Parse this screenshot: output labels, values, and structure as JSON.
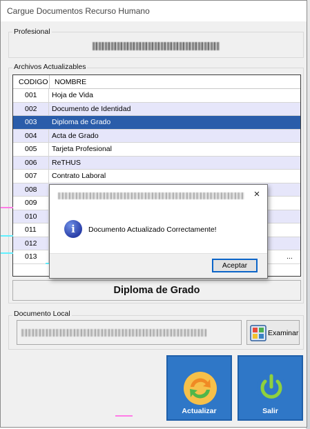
{
  "window": {
    "title": "Cargue Documentos Recurso Humano"
  },
  "profesional": {
    "label": "Profesional",
    "name_redacted": true
  },
  "archivos": {
    "label": "Archivos Actualizables",
    "columns": [
      "CODIGO",
      "NOMBRE"
    ],
    "rows": [
      {
        "codigo": "001",
        "nombre": "Hoja de Vida",
        "state": "normal"
      },
      {
        "codigo": "002",
        "nombre": "Documento de Identidad",
        "state": "alt"
      },
      {
        "codigo": "003",
        "nombre": "Diploma de Grado",
        "state": "selected"
      },
      {
        "codigo": "004",
        "nombre": "Acta de Grado",
        "state": "alt"
      },
      {
        "codigo": "005",
        "nombre": "Tarjeta Profesional",
        "state": "normal"
      },
      {
        "codigo": "006",
        "nombre": "ReTHUS",
        "state": "alt"
      },
      {
        "codigo": "007",
        "nombre": "Contrato Laboral",
        "state": "normal"
      },
      {
        "codigo": "008",
        "nombre": "",
        "state": "alt"
      },
      {
        "codigo": "009",
        "nombre": "",
        "state": "normal"
      },
      {
        "codigo": "010",
        "nombre": "",
        "state": "alt"
      },
      {
        "codigo": "011",
        "nombre": "",
        "state": "normal"
      },
      {
        "codigo": "012",
        "nombre": "",
        "state": "alt"
      },
      {
        "codigo": "013",
        "nombre": "...",
        "state": "normal"
      }
    ]
  },
  "selected_document": "Diploma de Grado",
  "documento_local": {
    "label": "Documento Local",
    "path_redacted": true
  },
  "buttons": {
    "examinar": "Examinar",
    "actualizar": "Actualizar",
    "salir": "Salir"
  },
  "dialog": {
    "message": "Documento Actualizado Correctamente!",
    "ok": "Aceptar",
    "close_glyph": "×",
    "icon": "info-icon",
    "title_redacted": true
  },
  "colors": {
    "selection": "#2a5daa",
    "alt_row": "#e6e6fa",
    "action_tile": "#2f77c7"
  }
}
